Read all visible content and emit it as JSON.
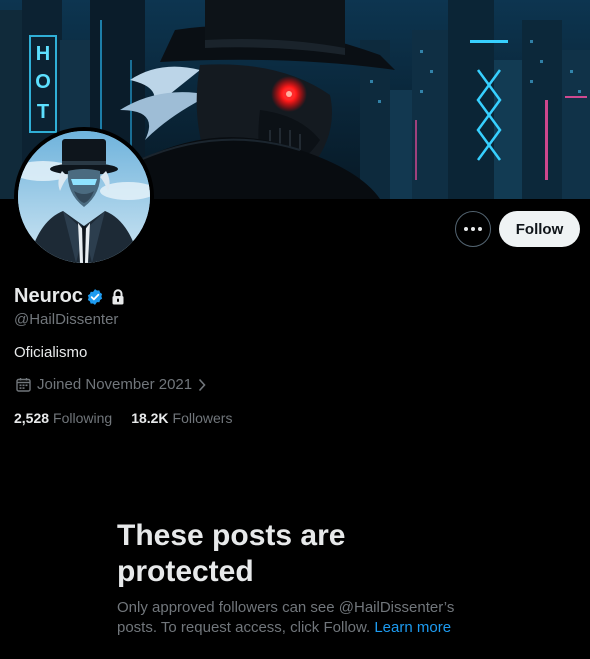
{
  "profile": {
    "display_name": "Neuroc",
    "handle": "@HailDissenter",
    "bio": "Oficialismo",
    "joined": "Joined November 2021",
    "following_count": "2,528",
    "following_label": "Following",
    "followers_count": "18.2K",
    "followers_label": "Followers",
    "verified": true,
    "protected": true
  },
  "banner": {
    "sign_text": "HOT"
  },
  "actions": {
    "follow_label": "Follow",
    "more_icon": "ellipsis-icon"
  },
  "protected_notice": {
    "title": "These posts are protected",
    "body_prefix": "Only approved followers can see @HailDissenter’s posts. To request access, click Follow.",
    "link_label": "Learn more"
  },
  "colors": {
    "background": "#000000",
    "primary_text": "#e7e9ea",
    "secondary_text": "#71767b",
    "accent": "#1d9bf0",
    "follow_button_bg": "#eff3f4"
  },
  "icons": [
    "verified-badge-icon",
    "lock-icon",
    "calendar-icon",
    "chevron-right-icon",
    "ellipsis-icon"
  ]
}
